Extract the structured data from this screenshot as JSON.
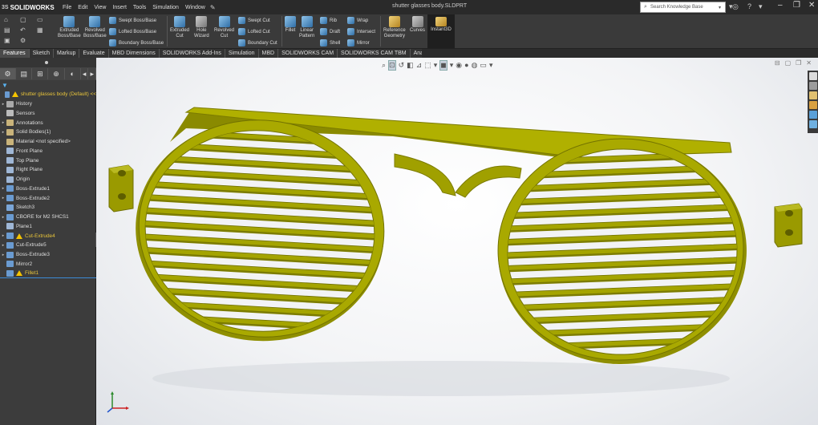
{
  "app": {
    "name": "SOLIDWORKS",
    "document_title": "shutter glasses body.SLDPRT"
  },
  "menu": [
    "File",
    "Edit",
    "View",
    "Insert",
    "Tools",
    "Simulation",
    "Window"
  ],
  "search": {
    "placeholder": "Search Knowledge Base"
  },
  "commands": {
    "extruded_boss": "Extruded\nBoss/Base",
    "revolved_boss": "Revolved\nBoss/Base",
    "swept_boss": "Swept Boss/Base",
    "lofted_boss": "Lofted Boss/Base",
    "boundary_boss": "Boundary Boss/Base",
    "extruded_cut": "Extruded\nCut",
    "hole_wizard": "Hole\nWizard",
    "revolved_cut": "Revolved\nCut",
    "swept_cut": "Swept Cut",
    "lofted_cut": "Lofted Cut",
    "boundary_cut": "Boundary Cut",
    "fillet": "Fillet",
    "linear_pattern": "Linear\nPattern",
    "rib": "Rib",
    "draft": "Draft",
    "shell": "Shell",
    "wrap": "Wrap",
    "intersect": "Intersect",
    "mirror": "Mirror",
    "reference_geometry": "Reference\nGeometry",
    "curves": "Curves",
    "instant3d": "Instant3D"
  },
  "tabs": [
    {
      "label": "Features",
      "active": true
    },
    {
      "label": "Sketch"
    },
    {
      "label": "Markup"
    },
    {
      "label": "Evaluate"
    },
    {
      "label": "MBD Dimensions"
    },
    {
      "label": "SOLIDWORKS Add-Ins"
    },
    {
      "label": "Simulation"
    },
    {
      "label": "MBD"
    },
    {
      "label": "SOLIDWORKS CAM"
    },
    {
      "label": "SOLIDWORKS CAM TBM"
    },
    {
      "label": "Analysis Preparation"
    }
  ],
  "tree": [
    {
      "label": "shutter glasses body (Default) <<",
      "icon": "part-icon",
      "warn": true,
      "yellow": true,
      "expand": false
    },
    {
      "label": "History",
      "icon": "history-icon",
      "expand": true
    },
    {
      "label": "Sensors",
      "icon": "sensors-icon",
      "expand": false
    },
    {
      "label": "Annotations",
      "icon": "annotations-icon",
      "expand": true
    },
    {
      "label": "Solid Bodies(1)",
      "icon": "solid-bodies-icon",
      "expand": true
    },
    {
      "label": "Material <not specified>",
      "icon": "material-icon",
      "expand": false
    },
    {
      "label": "Front Plane",
      "icon": "plane-icon",
      "expand": false
    },
    {
      "label": "Top Plane",
      "icon": "plane-icon",
      "expand": false
    },
    {
      "label": "Right Plane",
      "icon": "plane-icon",
      "expand": false
    },
    {
      "label": "Origin",
      "icon": "origin-icon",
      "expand": false
    },
    {
      "label": "Boss-Extrude1",
      "icon": "boss-extrude-icon",
      "expand": true
    },
    {
      "label": "Boss-Extrude2",
      "icon": "boss-extrude-icon",
      "expand": true
    },
    {
      "label": "Sketch3",
      "icon": "sketch-icon",
      "expand": false
    },
    {
      "label": "CBORE for M2 SHCS1",
      "icon": "hole-icon",
      "expand": true
    },
    {
      "label": "Plane1",
      "icon": "plane-icon",
      "expand": false
    },
    {
      "label": "Cut-Extrude4",
      "icon": "cut-extrude-icon",
      "warn": true,
      "yellow": true,
      "expand": true
    },
    {
      "label": "Cut-Extrude5",
      "icon": "cut-extrude-icon",
      "expand": true
    },
    {
      "label": "Boss-Extrude3",
      "icon": "boss-extrude-icon",
      "expand": true
    },
    {
      "label": "Mirror2",
      "icon": "mirror-icon",
      "expand": false
    },
    {
      "label": "Fillet1",
      "icon": "fillet-icon",
      "warn": true,
      "yellow": true,
      "expand": false,
      "selected": true
    }
  ],
  "colors": {
    "model": "#a7a800",
    "model_dark": "#7c7c00",
    "model_light": "#c4c42a",
    "accent": "#3c8ad6",
    "warning": "#f5c400"
  }
}
